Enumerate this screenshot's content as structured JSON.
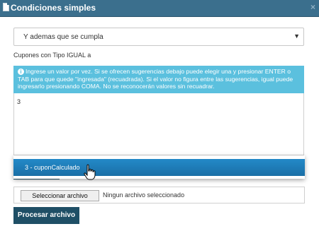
{
  "window": {
    "title": "Condiciones simples",
    "close_icon": "close-icon"
  },
  "condition_select": {
    "value": "Y ademas que se cumpla"
  },
  "field": {
    "label": "Cupones con Tipo IGUAL a",
    "info_text": "Ingrese un valor por vez. Si se ofrecen sugerencias debajo puede elegir una y presionar ENTER o TAB para que quede \"ingresada\" (recuadrada). Si el valor no figura entre las sugerencias, igual puede ingresarlo presionando COMA. No se reconocerán valores sin recuadrar.",
    "input_value": "3"
  },
  "suggestions": [
    {
      "label": "3 - cuponCalculado",
      "highlighted": true
    }
  ],
  "file_upload": {
    "button_label": "Seleccionar archivo",
    "status": "Ningun archivo seleccionado"
  },
  "actions": {
    "process_label": "Procesar archivo"
  },
  "colors": {
    "titlebar": "#3b6f8d",
    "info_bg": "#5bc0de",
    "suggestion_highlight": "#1a6fa6",
    "primary_button": "#1f4f66"
  }
}
